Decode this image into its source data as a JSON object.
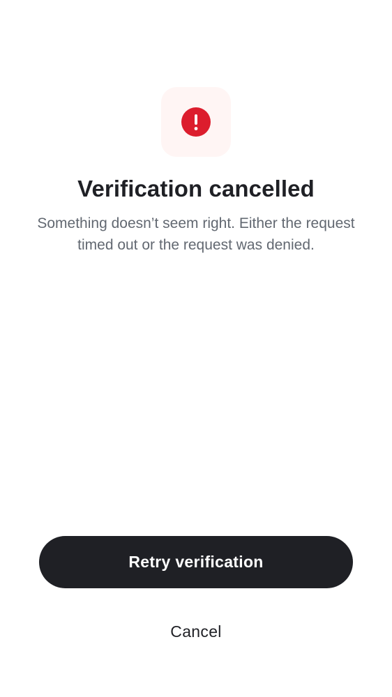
{
  "status": {
    "icon": "alert-circle-icon",
    "icon_color": "#dc1d2d",
    "tile_color": "#fff5f4"
  },
  "title": "Verification cancelled",
  "message": "Something doesn’t seem right. Either the request timed out or the request was denied.",
  "actions": {
    "retry_label": "Retry verification",
    "cancel_label": "Cancel"
  },
  "colors": {
    "primary_button": "#1f2025",
    "text_primary": "#1f2025",
    "text_secondary": "#626871"
  }
}
